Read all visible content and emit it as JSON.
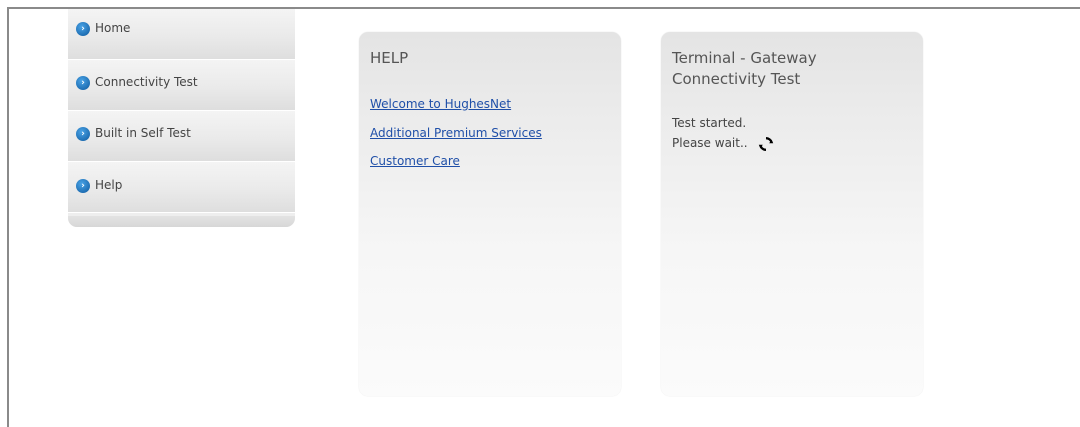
{
  "sidebar": {
    "items": [
      {
        "label": "Home",
        "icon": "chevron-right-circle-icon"
      },
      {
        "label": "Connectivity Test",
        "icon": "chevron-right-circle-icon"
      },
      {
        "label": "Built in Self Test",
        "icon": "chevron-right-circle-icon"
      },
      {
        "label": "Help",
        "icon": "chevron-right-circle-icon"
      }
    ]
  },
  "help_panel": {
    "title": "HELP",
    "links": [
      "Welcome to HughesNet",
      "Additional Premium Services",
      "Customer Care"
    ]
  },
  "test_panel": {
    "title_line1": "Terminal - Gateway",
    "title_line2": "Connectivity Test",
    "status_line1": "Test started.",
    "status_line2": "Please wait..",
    "spinner_icon": "refresh-spinner-icon"
  },
  "colors": {
    "accent": "#1f6fb4",
    "link": "#1f4fa8",
    "text": "#444444"
  }
}
